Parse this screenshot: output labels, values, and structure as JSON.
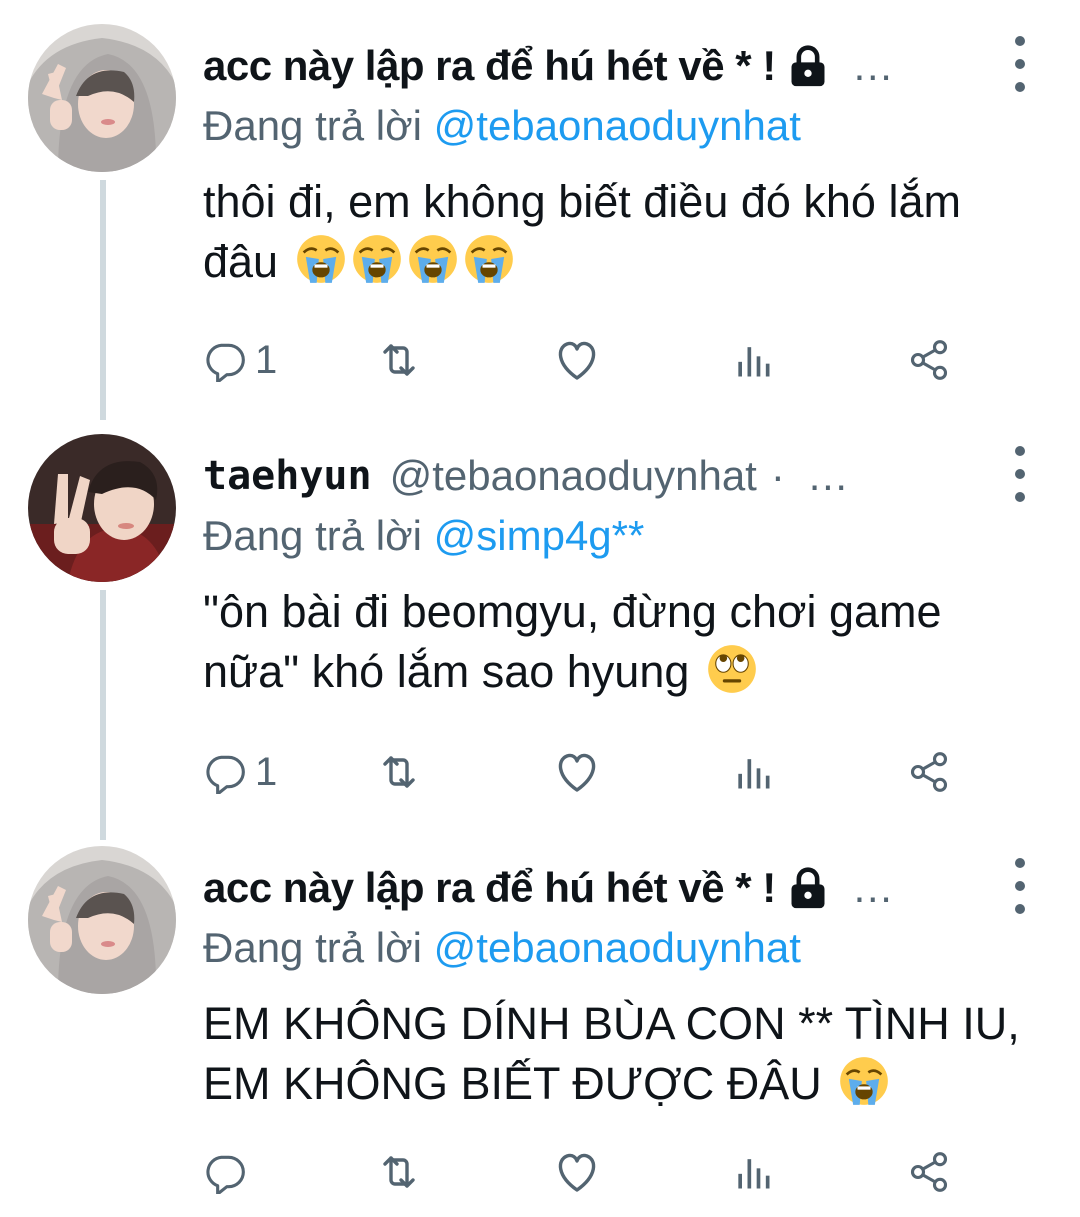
{
  "colors": {
    "accent": "#1d9bf0",
    "muted": "#536471",
    "text": "#0f1419",
    "thread_line": "#cfd9de"
  },
  "tweets": [
    {
      "name": "acc này lập ra để hú hét về * !",
      "handle": "",
      "locked": true,
      "ellipsis": "…",
      "reply_prefix": "Đang trả lời",
      "reply_to": "@tebaonaoduynhat",
      "text": "thôi đi, em không biết điều đó khó lắm đâu",
      "emojis": [
        "loudly-crying-face",
        "loudly-crying-face",
        "loudly-crying-face",
        "loudly-crying-face"
      ],
      "reply_count": "1"
    },
    {
      "name": "taehyun",
      "handle": "@tebaonaoduynhat",
      "dot": "·",
      "locked": false,
      "ellipsis": "…",
      "reply_prefix": "Đang trả lời",
      "reply_to": "@simp4g**",
      "text": "\"ôn bài đi beomgyu, đừng chơi game nữa\" khó lắm sao hyung",
      "emojis": [
        "face-with-rolling-eyes"
      ],
      "reply_count": "1"
    },
    {
      "name": "acc này lập ra để hú hét về * !",
      "handle": "",
      "locked": true,
      "ellipsis": "…",
      "reply_prefix": "Đang trả lời",
      "reply_to": "@tebaonaoduynhat",
      "text": "EM KHÔNG DÍNH BÙA CON ** TÌNH IU, EM KHÔNG BIẾT ĐƯỢC ĐÂU",
      "emojis": [
        "loudly-crying-face"
      ],
      "reply_count": ""
    }
  ]
}
